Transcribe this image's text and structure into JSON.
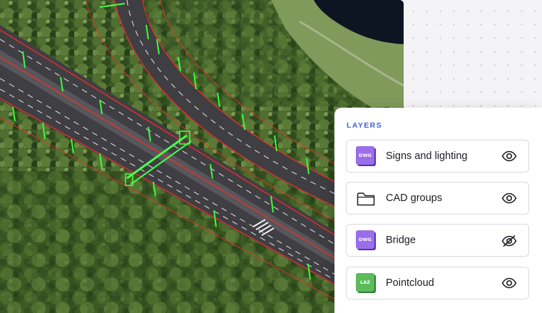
{
  "panel": {
    "title": "LAYERS",
    "layers": [
      {
        "name": "Signs and lighting",
        "icon": "dwg-file-icon",
        "tile_text": "DWG",
        "visible": true
      },
      {
        "name": "CAD groups",
        "icon": "folder-icon",
        "tile_text": "",
        "visible": true
      },
      {
        "name": "Bridge",
        "icon": "dwg-file-icon",
        "tile_text": "DWG",
        "visible": false
      },
      {
        "name": "Pointcloud",
        "icon": "laz-file-icon",
        "tile_text": "LAZ",
        "visible": true
      }
    ]
  },
  "colors": {
    "accent": "#3e5fd8",
    "dwg": "#9a6ee8",
    "laz": "#5cbb5a",
    "cad_lines": "#ff2a2a",
    "cad_markers": "#39ff3a"
  }
}
